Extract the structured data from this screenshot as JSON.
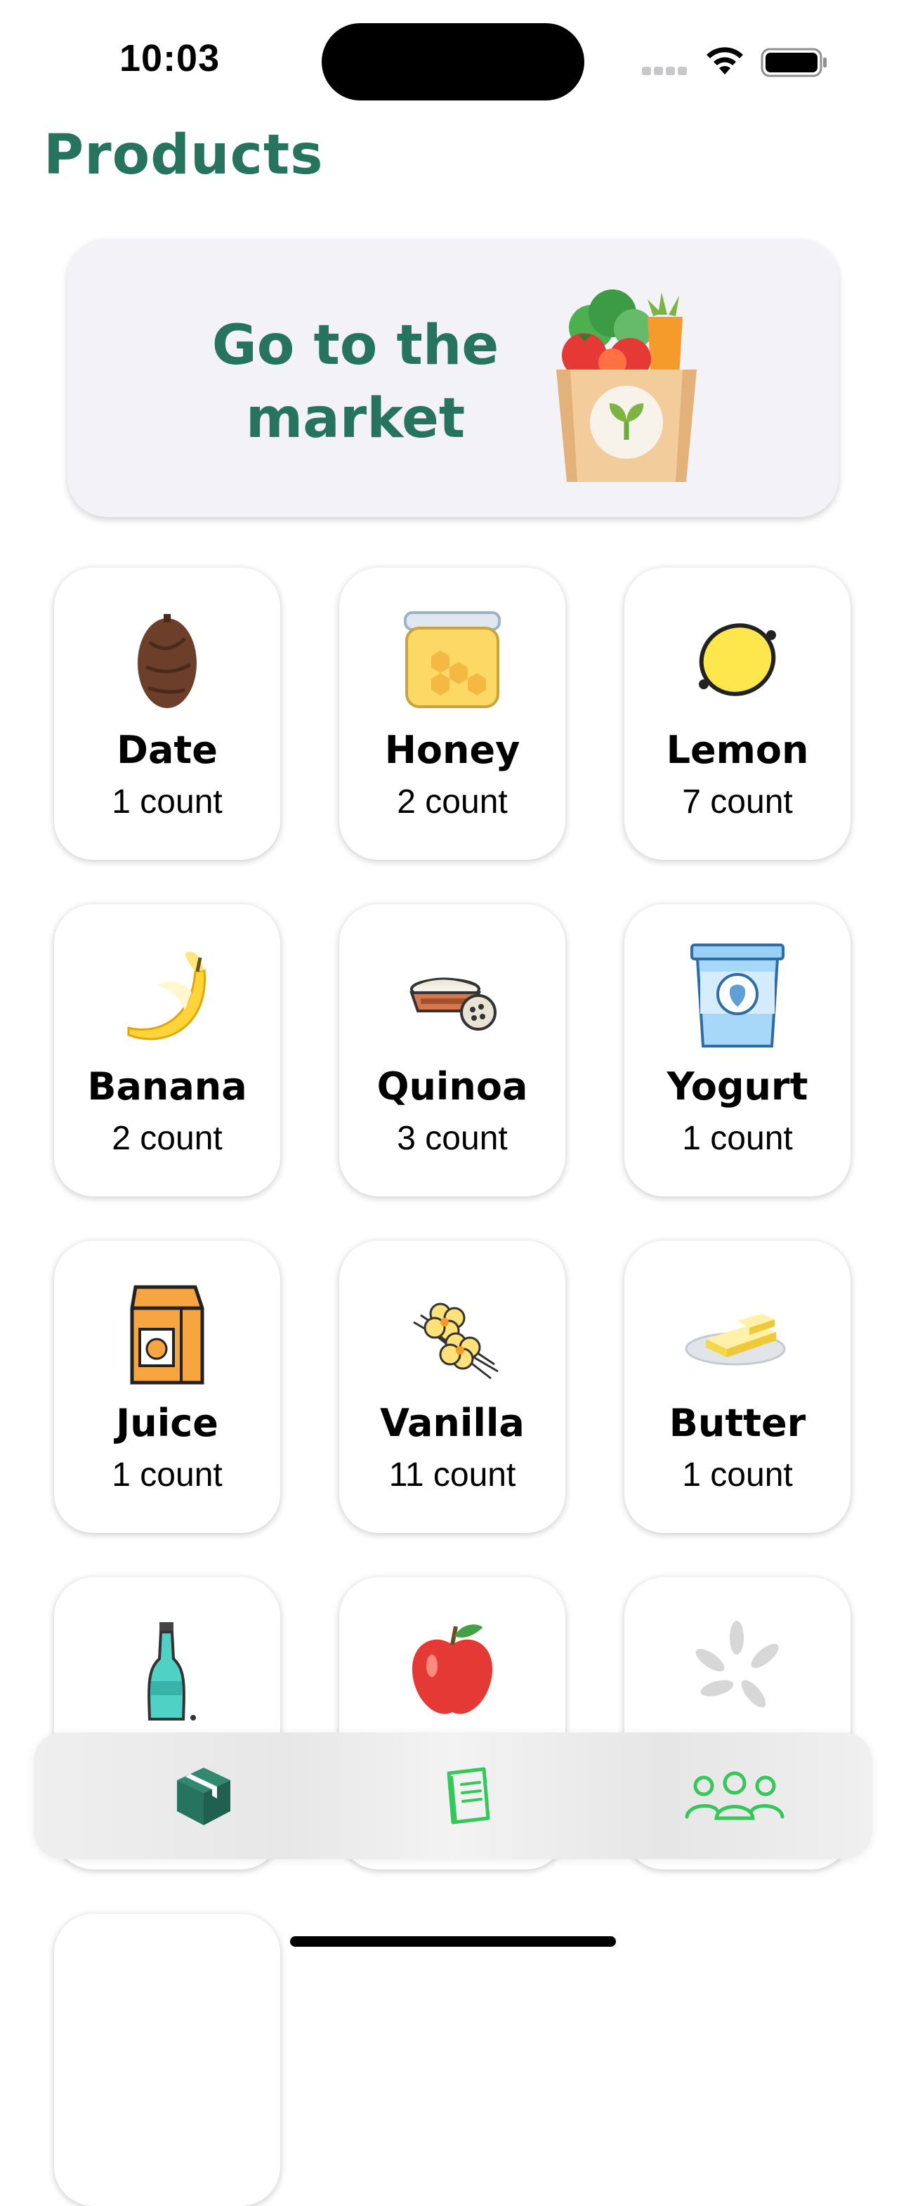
{
  "status_bar": {
    "time": "10:03"
  },
  "header": {
    "title": "Products"
  },
  "banner": {
    "text": "Go to the market",
    "icon": "grocery-bag-icon"
  },
  "colors": {
    "accent": "#26735e",
    "tab_active": "#26735e",
    "tab_inactive": "#34c759",
    "card_background": "#ffffff",
    "banner_background": "#f2f2f7"
  },
  "products": [
    {
      "name": "Date",
      "count": "1 count",
      "icon": "date-icon"
    },
    {
      "name": "Honey",
      "count": "2 count",
      "icon": "honey-jar-icon"
    },
    {
      "name": "Lemon",
      "count": "7 count",
      "icon": "lemon-icon"
    },
    {
      "name": "Banana",
      "count": "2 count",
      "icon": "banana-icon"
    },
    {
      "name": "Quinoa",
      "count": "3 count",
      "icon": "quinoa-bowl-icon"
    },
    {
      "name": "Yogurt",
      "count": "1 count",
      "icon": "yogurt-cup-icon"
    },
    {
      "name": "Juice",
      "count": "1 count",
      "icon": "juice-carton-icon"
    },
    {
      "name": "Vanilla",
      "count": "11 count",
      "icon": "vanilla-flower-icon"
    },
    {
      "name": "Butter",
      "count": "1 count",
      "icon": "butter-dish-icon"
    },
    {
      "name": "",
      "count": "",
      "icon": "soda-bottle-icon"
    },
    {
      "name": "",
      "count": "",
      "icon": "apple-icon"
    },
    {
      "name": "",
      "count": "",
      "icon": "rice-grains-icon"
    }
  ],
  "tab_bar": {
    "tabs": [
      {
        "icon": "box-icon",
        "active": true
      },
      {
        "icon": "notebook-icon",
        "active": false
      },
      {
        "icon": "people-icon",
        "active": false
      }
    ]
  }
}
